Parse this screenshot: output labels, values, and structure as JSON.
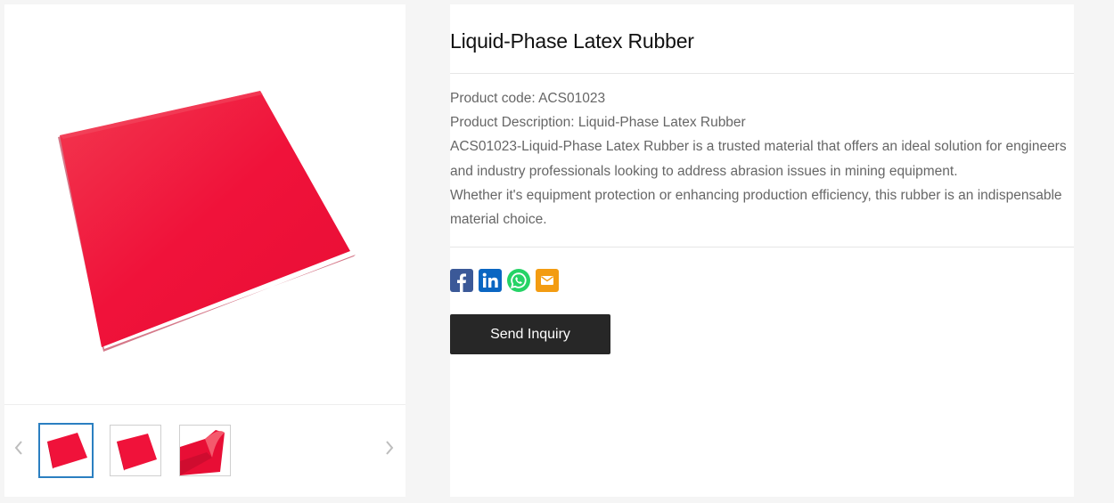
{
  "product": {
    "title": "Liquid-Phase Latex Rubber",
    "code_line": "Product code: ACS01023",
    "description_line": "Product Description: Liquid-Phase Latex Rubber",
    "paragraph_1": "ACS01023-Liquid-Phase Latex Rubber is a trusted material that offers an ideal solution for engineers and industry professionals looking to address abrasion issues in mining equipment.",
    "paragraph_2": "Whether it's equipment protection or enhancing production efficiency, this rubber is an indispensable material choice."
  },
  "gallery": {
    "main_image": "red-rubber-sheet",
    "thumbnails": [
      {
        "image": "red-rubber-sheet",
        "active": true
      },
      {
        "image": "red-rubber-sheet",
        "active": false
      },
      {
        "image": "red-rubber-roll",
        "active": false
      }
    ],
    "prev_icon": "chevron-left-icon",
    "next_icon": "chevron-right-icon"
  },
  "share": {
    "icons": [
      "facebook-icon",
      "linkedin-icon",
      "whatsapp-icon",
      "email-icon"
    ]
  },
  "actions": {
    "inquiry_label": "Send Inquiry"
  },
  "colors": {
    "product_red": "#f0123a",
    "button_dark": "#272727",
    "thumb_active_border": "#2b7fc1",
    "facebook": "#3b5998",
    "linkedin": "#0a66c2",
    "whatsapp": "#25d366",
    "email": "#f39c12"
  }
}
